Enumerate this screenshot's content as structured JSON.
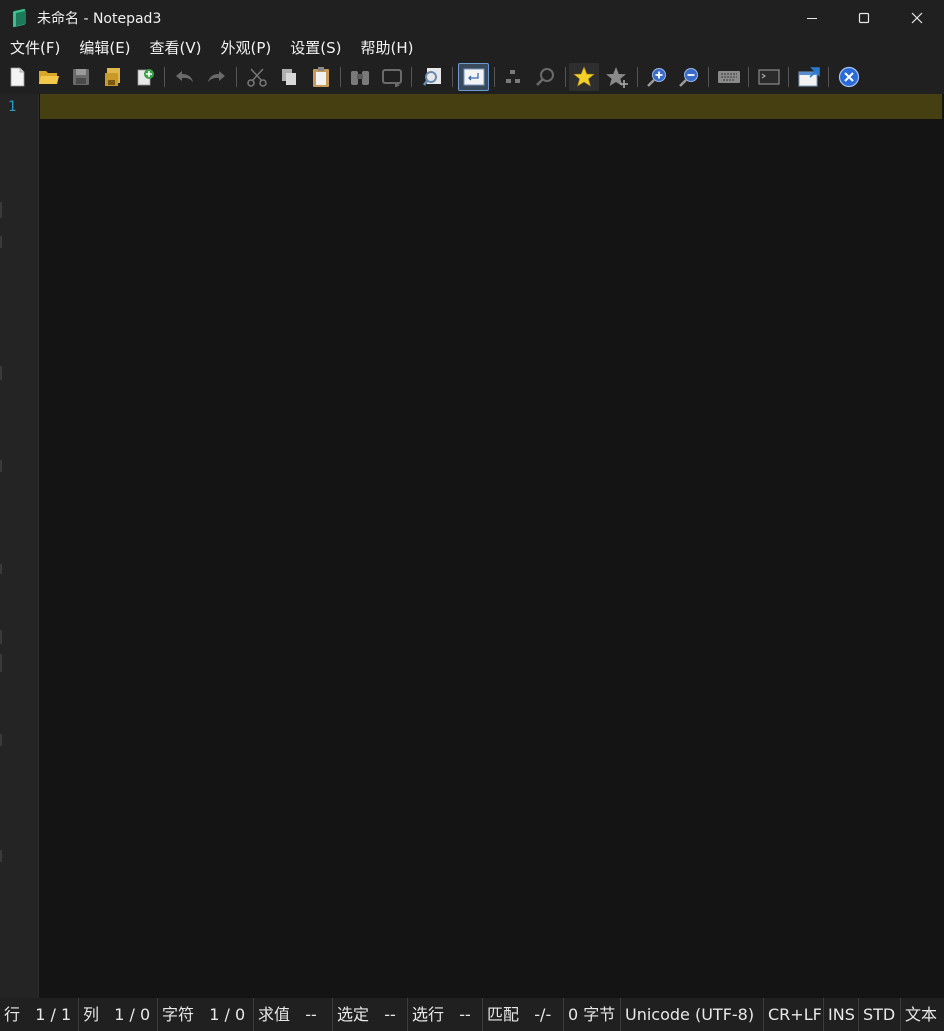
{
  "window": {
    "title": "未命名 - Notepad3"
  },
  "menu": [
    "文件(F)",
    "编辑(E)",
    "查看(V)",
    "外观(P)",
    "设置(S)",
    "帮助(H)"
  ],
  "toolbar": [
    {
      "name": "new-file-icon",
      "active": false
    },
    {
      "name": "open-folder-icon",
      "active": false
    },
    {
      "name": "save-icon",
      "active": false
    },
    {
      "name": "save-as-icon",
      "active": false
    },
    {
      "name": "save-copy-icon",
      "active": false
    },
    {
      "name": "undo-icon",
      "active": false
    },
    {
      "name": "redo-icon",
      "active": false
    },
    {
      "name": "cut-icon",
      "active": false
    },
    {
      "name": "copy-icon",
      "active": false
    },
    {
      "name": "paste-icon",
      "active": false
    },
    {
      "name": "find-binoculars-icon",
      "active": false
    },
    {
      "name": "replace-icon",
      "active": false
    },
    {
      "name": "find-in-files-icon",
      "active": false
    },
    {
      "name": "word-wrap-icon",
      "active": true
    },
    {
      "name": "fold-icon",
      "active": false
    },
    {
      "name": "mark-occurrences-icon",
      "active": false
    },
    {
      "name": "favorites-star-icon",
      "active": false
    },
    {
      "name": "add-favorite-icon",
      "active": false
    },
    {
      "name": "zoom-in-icon",
      "active": false
    },
    {
      "name": "zoom-out-icon",
      "active": false
    },
    {
      "name": "keyboard-icon",
      "active": false
    },
    {
      "name": "terminal-icon",
      "active": false
    },
    {
      "name": "pin-window-icon",
      "active": false
    },
    {
      "name": "exit-icon",
      "active": false
    }
  ],
  "editor": {
    "line_number": "1"
  },
  "status": {
    "line_label": "行",
    "line_value": "1 / 1",
    "col_label": "列",
    "col_value": "1 / 0",
    "char_label": "字符",
    "char_value": "1 / 0",
    "eval_label": "求值",
    "eval_value": "--",
    "sel_label": "选定",
    "sel_value": "--",
    "sel_lines_label": "选行",
    "sel_lines_value": "--",
    "match_label": "匹配",
    "match_value": "-/-",
    "bytes": "0 字节",
    "encoding": "Unicode (UTF-8)",
    "eol": "CR+LF",
    "ovr": "INS",
    "mode": "STD",
    "lexer": "文本"
  }
}
